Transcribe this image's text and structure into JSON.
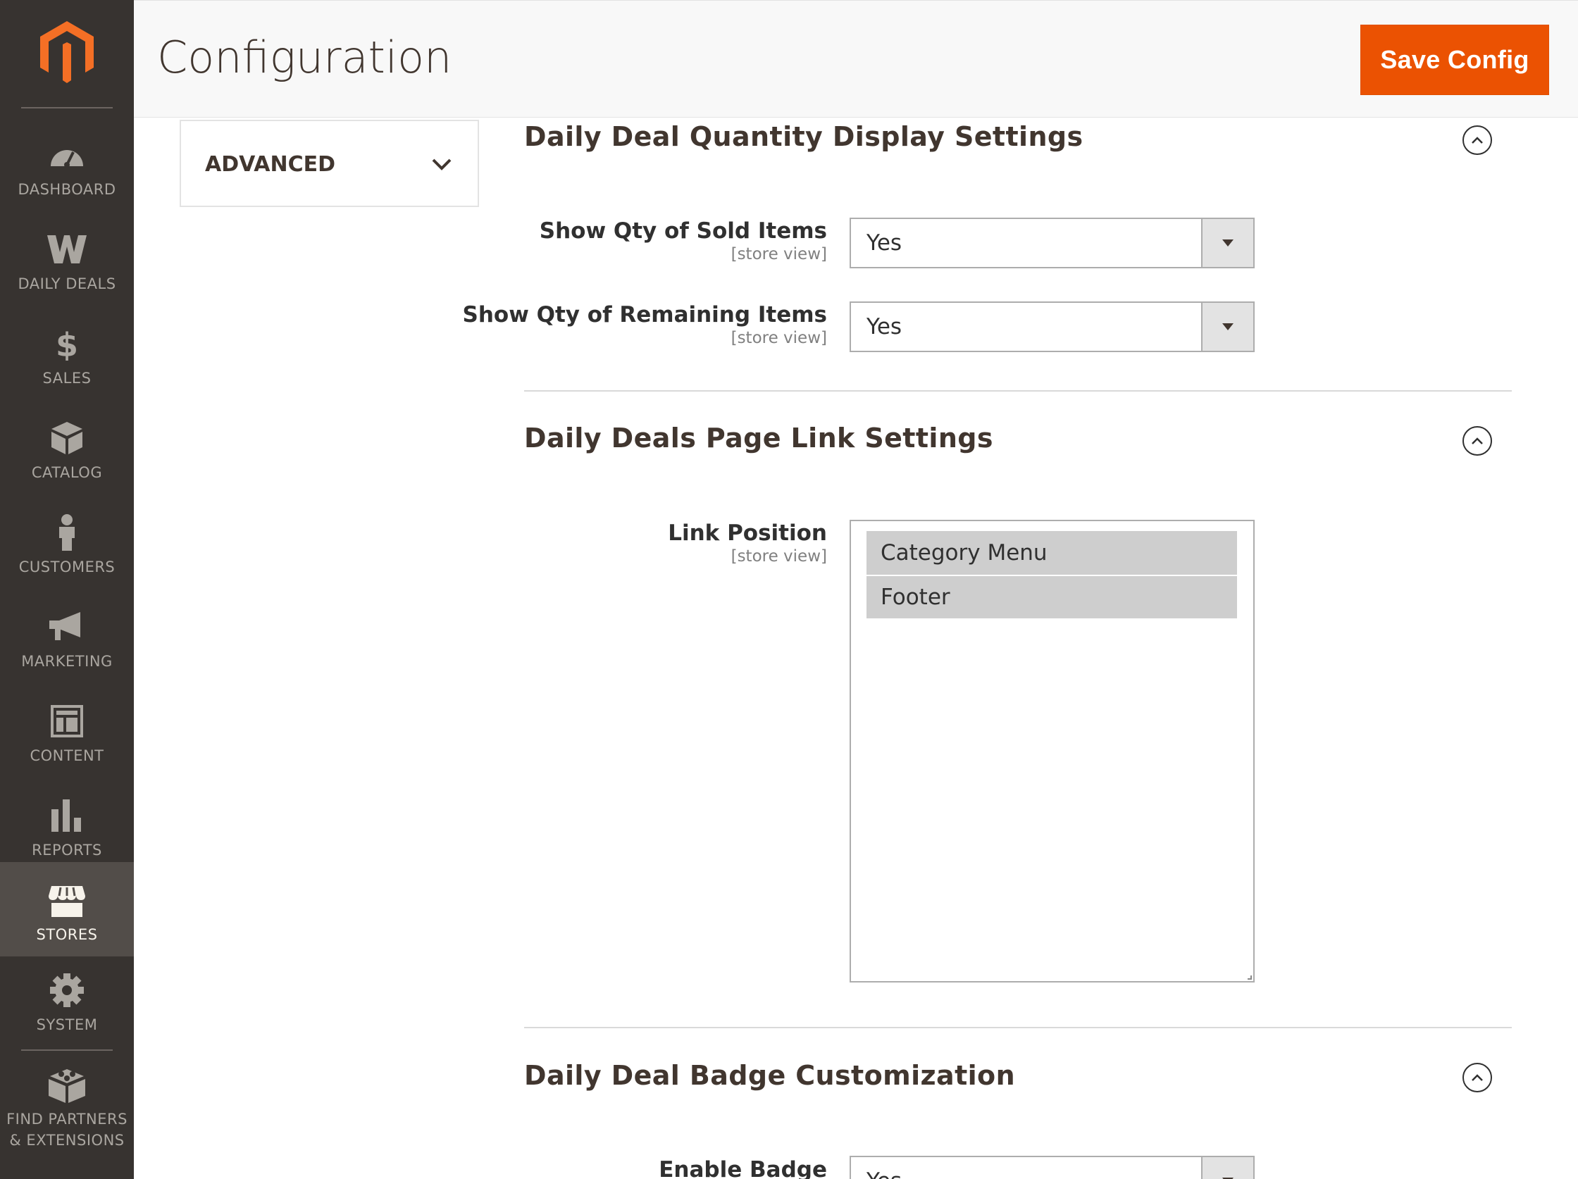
{
  "app": {
    "page_title": "Configuration",
    "save_button": "Save Config"
  },
  "sidebar": {
    "items": [
      {
        "label": "DASHBOARD",
        "icon": "dashboard-icon"
      },
      {
        "label": "DAILY DEALS",
        "icon": "daily-deals-icon"
      },
      {
        "label": "SALES",
        "icon": "dollar-icon"
      },
      {
        "label": "CATALOG",
        "icon": "box-icon"
      },
      {
        "label": "CUSTOMERS",
        "icon": "person-icon"
      },
      {
        "label": "MARKETING",
        "icon": "megaphone-icon"
      },
      {
        "label": "CONTENT",
        "icon": "layout-icon"
      },
      {
        "label": "REPORTS",
        "icon": "bar-chart-icon"
      },
      {
        "label": "STORES",
        "icon": "storefront-icon",
        "active": true
      },
      {
        "label": "SYSTEM",
        "icon": "gear-icon"
      },
      {
        "label": "FIND PARTNERS\n& EXTENSIONS",
        "label_line1": "FIND PARTNERS",
        "label_line2": "& EXTENSIONS",
        "icon": "blocks-icon"
      }
    ]
  },
  "tabs": {
    "advanced_label": "ADVANCED"
  },
  "sections": [
    {
      "title": "Daily Deal Quantity Display Settings",
      "fields": [
        {
          "label": "Show Qty of Sold Items",
          "scope": "[store view]",
          "value": "Yes"
        },
        {
          "label": "Show Qty of Remaining Items",
          "scope": "[store view]",
          "value": "Yes"
        }
      ]
    },
    {
      "title": "Daily Deals Page Link Settings",
      "fields": [
        {
          "label": "Link Position",
          "scope": "[store view]",
          "options": [
            "Category Menu",
            "Footer"
          ]
        }
      ]
    },
    {
      "title": "Daily Deal Badge Customization",
      "fields": [
        {
          "label": "Enable Badge",
          "value": "Yes"
        }
      ]
    }
  ],
  "colors": {
    "sidebar_bg": "#373330",
    "sidebar_active": "#524d49",
    "accent": "#eb5202",
    "logo": "#f46f25"
  }
}
